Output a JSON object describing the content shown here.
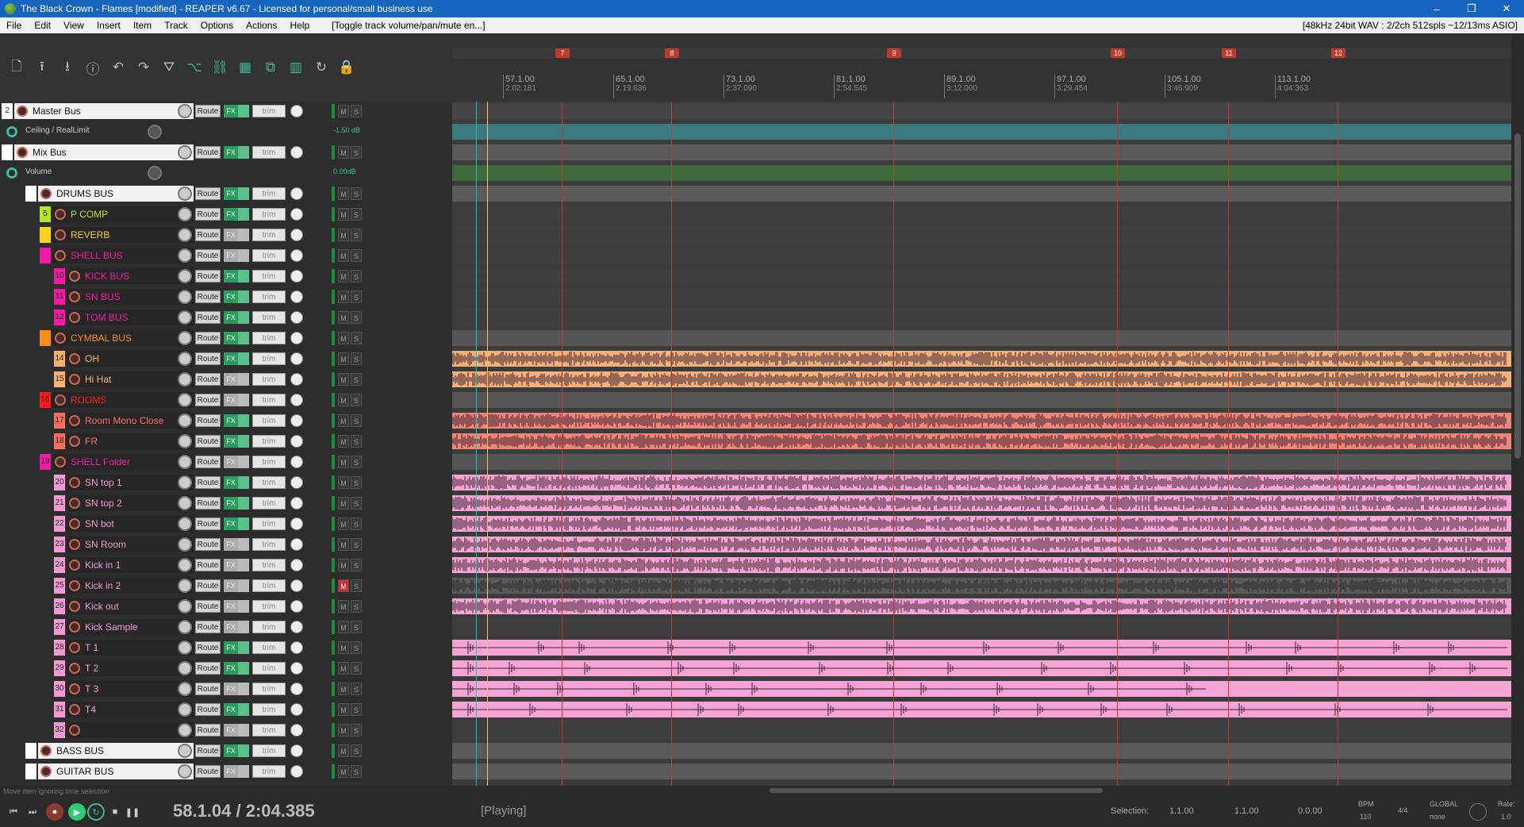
{
  "window": {
    "title": "The Black Crown - Flames [modified] - REAPER v6.67 - Licensed for personal/small business use",
    "controls": [
      "–",
      "❐",
      "✕"
    ]
  },
  "menu": {
    "items": [
      "File",
      "Edit",
      "View",
      "Insert",
      "Item",
      "Track",
      "Options",
      "Actions",
      "Help"
    ],
    "action_hint": "[Toggle track volume/pan/mute en...]",
    "audio_status": "[48kHz 24bit WAV : 2/2ch 512spls ~12/13ms ASIO]"
  },
  "toolbar": {
    "icons": [
      "new-project-icon",
      "open-project-icon",
      "save-project-icon",
      "project-info-icon",
      "undo-icon",
      "redo-icon",
      "metronome-icon",
      "ripple-edit-icon",
      "link-icon",
      "grid-icon",
      "snap-icon",
      "grid-lines-icon",
      "loop-icon",
      "lock-icon"
    ],
    "glyphs": [
      "🗋",
      "⭱",
      "⭳",
      "ⓘ",
      "↶",
      "↷",
      "⛛",
      "⌥",
      "⛓",
      "▦",
      "⧉",
      "▥",
      "↻",
      "🔒"
    ]
  },
  "ruler": {
    "markers": [
      "7",
      "8",
      "9",
      "10",
      "11",
      "12"
    ],
    "bars": [
      {
        "label": "57.1.00",
        "time": "2:02.181"
      },
      {
        "label": "65.1.00",
        "time": "2:19.636"
      },
      {
        "label": "73.1.00",
        "time": "2:37.090"
      },
      {
        "label": "81.1.00",
        "time": "2:54.545"
      },
      {
        "label": "89.1.00",
        "time": "3:12.000"
      },
      {
        "label": "97.1.00",
        "time": "3:29.454"
      },
      {
        "label": "105.1.00",
        "time": "3:46.909"
      },
      {
        "label": "113.1.00",
        "time": "4:04.363"
      }
    ]
  },
  "track_common": {
    "route_label": "Route",
    "fx_label": "FX",
    "trim_label": "trim",
    "mute_label": "M",
    "solo_label": "S"
  },
  "tracks": [
    {
      "num": "2",
      "name": "Master Bus",
      "color": "#ffffff",
      "indent": 0,
      "fx": true
    },
    {
      "num": "",
      "name": "Ceiling / RealLimit",
      "envelope": true,
      "value": "-1.50 dB",
      "indent": 0
    },
    {
      "num": "",
      "name": "Mix Bus",
      "color": "#ffffff",
      "indent": 0,
      "fx": true
    },
    {
      "num": "",
      "name": "Volume",
      "envelope": true,
      "value": "0.00dB",
      "indent": 0
    },
    {
      "num": "",
      "name": "DRUMS BUS",
      "color": "#ffffff",
      "indent": 1,
      "fx": true
    },
    {
      "num": "5",
      "name": "P COMP",
      "color": "#b5e61d",
      "indent": 2,
      "fx": true
    },
    {
      "num": "",
      "name": "REVERB",
      "color": "#ffd21f",
      "indent": 2,
      "fx": false
    },
    {
      "num": "",
      "name": "SHELL BUS",
      "color": "#f01aa5",
      "indent": 2,
      "fx": false
    },
    {
      "num": "10",
      "name": "KICK BUS",
      "color": "#f01aa5",
      "indent": 3,
      "fx": true
    },
    {
      "num": "11",
      "name": "SN BUS",
      "color": "#f01aa5",
      "indent": 3,
      "fx": true
    },
    {
      "num": "12",
      "name": "TOM BUS",
      "color": "#f01aa5",
      "indent": 3,
      "fx": true
    },
    {
      "num": "",
      "name": "CYMBAL BUS",
      "color": "#ff8c1a",
      "indent": 2,
      "fx": true
    },
    {
      "num": "14",
      "name": "OH",
      "color": "#ffb070",
      "indent": 3,
      "fx": true
    },
    {
      "num": "15",
      "name": "Hi Hat",
      "color": "#ffb070",
      "indent": 3,
      "fx": false
    },
    {
      "num": "16",
      "name": "ROOMS",
      "color": "#ff1a1a",
      "indent": 2,
      "fx": false
    },
    {
      "num": "17",
      "name": "Room Mono Close",
      "color": "#ff6d5e",
      "indent": 3,
      "fx": true
    },
    {
      "num": "18",
      "name": "FR",
      "color": "#ff6d5e",
      "indent": 3,
      "fx": true
    },
    {
      "num": "19",
      "name": "SHELL Folder",
      "color": "#f01aa5",
      "indent": 2,
      "fx": false
    },
    {
      "num": "20",
      "name": "SN top 1",
      "color": "#f79ad3",
      "indent": 3,
      "fx": true
    },
    {
      "num": "21",
      "name": "SN top 2",
      "color": "#f79ad3",
      "indent": 3,
      "fx": true
    },
    {
      "num": "22",
      "name": "SN bot",
      "color": "#f79ad3",
      "indent": 3,
      "fx": true
    },
    {
      "num": "23",
      "name": "SN Room",
      "color": "#f79ad3",
      "indent": 3,
      "fx": false
    },
    {
      "num": "24",
      "name": "Kick in 1",
      "color": "#f79ad3",
      "indent": 3,
      "fx": false
    },
    {
      "num": "25",
      "name": "Kick in 2",
      "color": "#f79ad3",
      "indent": 3,
      "fx": false,
      "muted": true
    },
    {
      "num": "26",
      "name": "Kick out",
      "color": "#f79ad3",
      "indent": 3,
      "fx": false
    },
    {
      "num": "27",
      "name": "Kick Sample",
      "color": "#f79ad3",
      "indent": 3,
      "fx": false
    },
    {
      "num": "28",
      "name": "T 1",
      "color": "#f79ad3",
      "indent": 3,
      "fx": true
    },
    {
      "num": "29",
      "name": "T 2",
      "color": "#f79ad3",
      "indent": 3,
      "fx": true
    },
    {
      "num": "30",
      "name": "T 3",
      "color": "#f79ad3",
      "indent": 3,
      "fx": false
    },
    {
      "num": "31",
      "name": "T4",
      "color": "#f79ad3",
      "indent": 3,
      "fx": true
    },
    {
      "num": "32",
      "name": "",
      "color": "#f79ad3",
      "indent": 3,
      "fx": false
    },
    {
      "num": "",
      "name": "BASS BUS",
      "color": "#ffffff",
      "indent": 1,
      "fx": true
    },
    {
      "num": "",
      "name": "GUITAR BUS",
      "color": "#ffffff",
      "indent": 1,
      "fx": false
    }
  ],
  "arrange": {
    "lanes": [
      {
        "color": "#454545",
        "kind": "empty"
      },
      {
        "color": "#3b7a80",
        "kind": "env"
      },
      {
        "color": "#5a5a5a",
        "kind": "empty"
      },
      {
        "color": "#3d6b3d",
        "kind": "env"
      },
      {
        "color": "#5a5a5a",
        "kind": "empty"
      },
      {
        "color": "#3e3e3e",
        "kind": "empty"
      },
      {
        "color": "#3e3e3e",
        "kind": "empty"
      },
      {
        "color": "#3e3e3e",
        "kind": "empty"
      },
      {
        "color": "#3e3e3e",
        "kind": "empty"
      },
      {
        "color": "#3e3e3e",
        "kind": "empty"
      },
      {
        "color": "#3e3e3e",
        "kind": "empty"
      },
      {
        "color": "#555555",
        "kind": "folder"
      },
      {
        "color": "#f5b07c",
        "kind": "dense"
      },
      {
        "color": "#f5b07c",
        "kind": "hats"
      },
      {
        "color": "#555555",
        "kind": "folder"
      },
      {
        "color": "#f0857a",
        "kind": "dense"
      },
      {
        "color": "#f0857a",
        "kind": "dense"
      },
      {
        "color": "#555555",
        "kind": "folder"
      },
      {
        "color": "#f7a3d6",
        "kind": "dense"
      },
      {
        "color": "#f7a3d6",
        "kind": "dense"
      },
      {
        "color": "#f7a3d6",
        "kind": "dense"
      },
      {
        "color": "#f7a3d6",
        "kind": "dense"
      },
      {
        "color": "#f7a3d6",
        "kind": "dense"
      },
      {
        "color": "#5a5a5a",
        "kind": "dense"
      },
      {
        "color": "#f7a3d6",
        "kind": "dense"
      },
      {
        "color": "#3e3e3e",
        "kind": "empty"
      },
      {
        "color": "#f7a3d6",
        "kind": "sparse"
      },
      {
        "color": "#f7a3d6",
        "kind": "sparse"
      },
      {
        "color": "#f7a3d6",
        "kind": "sparse-short"
      },
      {
        "color": "#f7a3d6",
        "kind": "sparse"
      },
      {
        "color": "#3e3e3e",
        "kind": "empty"
      },
      {
        "color": "#5a5a5a",
        "kind": "folder"
      },
      {
        "color": "#5a5a5a",
        "kind": "folder"
      }
    ],
    "marker_lines": [
      "7",
      "8",
      "9",
      "10",
      "11",
      "12"
    ]
  },
  "transport": {
    "hint": "Move item ignoring time selection",
    "time": "58.1.04 / 2:04.385",
    "state": "[Playing]",
    "selection_label": "Selection:",
    "selection_start": "1.1.00",
    "selection_end": "1.1.00",
    "selection_length": "0.0.00",
    "bpm_label": "BPM",
    "bpm": "110",
    "time_sig": "4/4",
    "global_label": "GLOBAL",
    "global_value": "none",
    "rate_label": "Rate:",
    "rate": "1.0"
  }
}
